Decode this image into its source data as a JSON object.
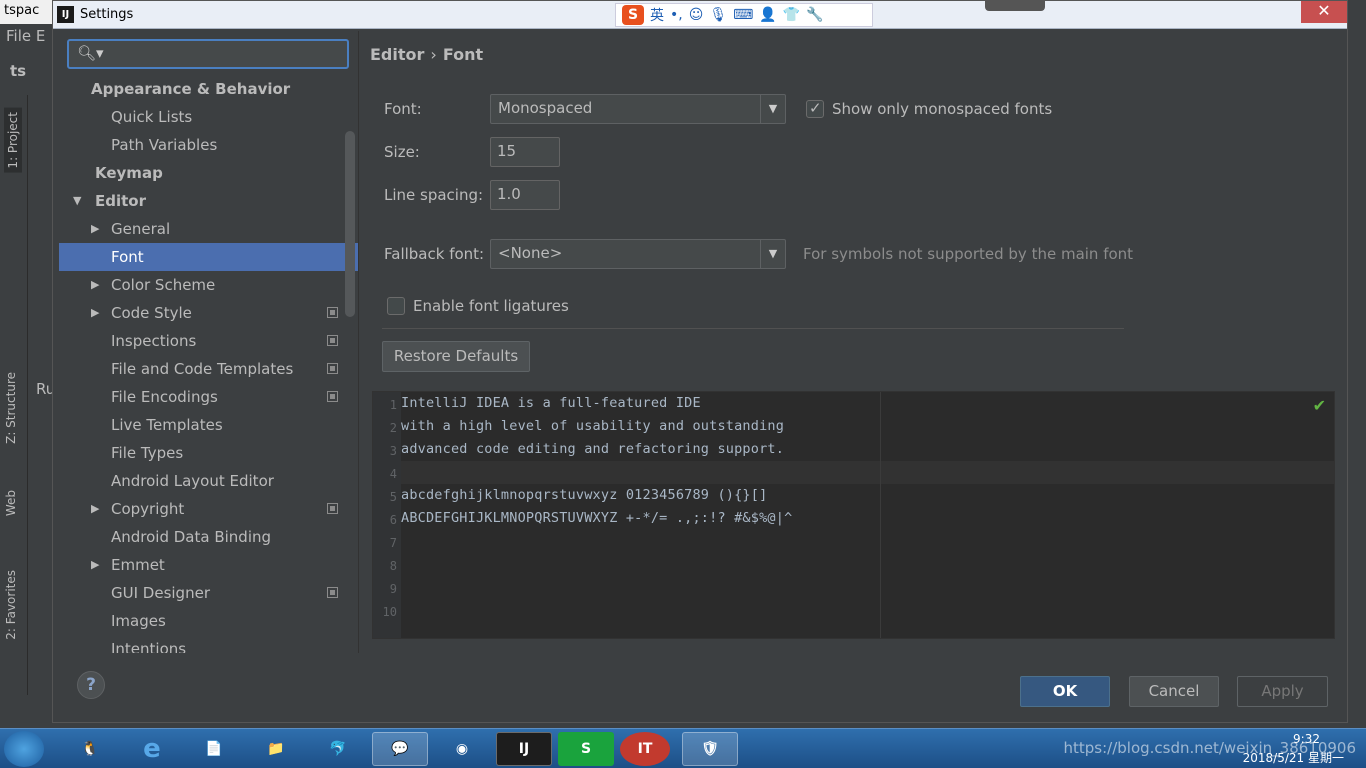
{
  "ide": {
    "title": "tspac",
    "menu_file": "File",
    "menu_edit": "E",
    "project_label": "ts",
    "run_label": "Ru",
    "tabs": {
      "project": "1: Project",
      "structure": "Z: Structure",
      "web": "Web",
      "favorites": "2: Favorites"
    }
  },
  "dialog": {
    "title": "Settings",
    "app_icon": "IJ",
    "close": "✕"
  },
  "ime": {
    "logo": "S",
    "mode": "英"
  },
  "search": {
    "placeholder": ""
  },
  "tree": [
    {
      "label": "Appearance & Behavior",
      "level": 0,
      "bold": true
    },
    {
      "label": "Quick Lists",
      "level": 1
    },
    {
      "label": "Path Variables",
      "level": 1
    },
    {
      "label": "Keymap",
      "level": 0,
      "bold": true
    },
    {
      "label": "Editor",
      "level": 0,
      "bold": true,
      "expanded": true
    },
    {
      "label": "General",
      "level": 1,
      "collapsed": true
    },
    {
      "label": "Font",
      "level": 1,
      "selected": true
    },
    {
      "label": "Color Scheme",
      "level": 1,
      "collapsed": true
    },
    {
      "label": "Code Style",
      "level": 1,
      "collapsed": true,
      "project": true
    },
    {
      "label": "Inspections",
      "level": 1,
      "project": true
    },
    {
      "label": "File and Code Templates",
      "level": 1,
      "project": true
    },
    {
      "label": "File Encodings",
      "level": 1,
      "project": true
    },
    {
      "label": "Live Templates",
      "level": 1
    },
    {
      "label": "File Types",
      "level": 1
    },
    {
      "label": "Android Layout Editor",
      "level": 1
    },
    {
      "label": "Copyright",
      "level": 1,
      "collapsed": true,
      "project": true
    },
    {
      "label": "Android Data Binding",
      "level": 1
    },
    {
      "label": "Emmet",
      "level": 1,
      "collapsed": true
    },
    {
      "label": "GUI Designer",
      "level": 1,
      "project": true
    },
    {
      "label": "Images",
      "level": 1
    },
    {
      "label": "Intentions",
      "level": 1
    }
  ],
  "breadcrumb": {
    "parent": "Editor",
    "separator": "›",
    "current": "Font"
  },
  "form": {
    "font_label": "Font:",
    "font_value": "Monospaced",
    "show_mono_label": "Show only monospaced fonts",
    "show_mono_checked": true,
    "size_label": "Size:",
    "size_value": "15",
    "line_spacing_label": "Line spacing:",
    "line_spacing_value": "1.0",
    "fallback_label": "Fallback font:",
    "fallback_value": "<None>",
    "fallback_hint": "For symbols not supported by the main font",
    "ligatures_label": "Enable font ligatures",
    "ligatures_checked": false,
    "restore_defaults": "Restore Defaults"
  },
  "preview": {
    "line_numbers": [
      "1",
      "2",
      "3",
      "4",
      "5",
      "6",
      "7",
      "8",
      "9",
      "10"
    ],
    "lines": [
      "IntelliJ IDEA is a full-featured IDE",
      "with a high level of usability and outstanding",
      "advanced code editing and refactoring support.",
      "",
      "abcdefghijklmnopqrstuvwxyz 0123456789 (){}[]",
      "ABCDEFGHIJKLMNOPQRSTUVWXYZ +-*/= .,;:!? #&$%@|^",
      "",
      "",
      "",
      ""
    ]
  },
  "buttons": {
    "help": "?",
    "ok": "OK",
    "cancel": "Cancel",
    "apply": "Apply"
  },
  "taskbar": {
    "app_intellij": "IJ",
    "app_s": "S",
    "app_it": "IT",
    "time": "9:32",
    "date": "2018/5/21 星期一",
    "watermark": "https://blog.csdn.net/weixin_38610906"
  },
  "colors": {
    "selection": "#4b6eaf",
    "ok_button": "#365880",
    "background": "#3c3f41",
    "editor_bg": "#2b2b2b"
  }
}
